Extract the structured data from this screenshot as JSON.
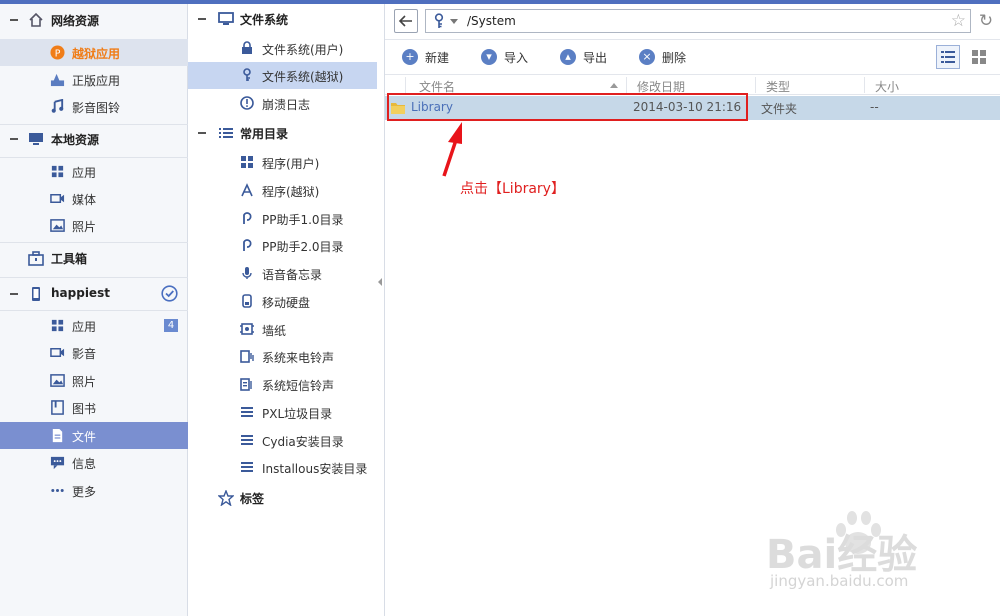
{
  "sidebar": {
    "network": {
      "title": "网络资源",
      "items": [
        {
          "label": "越狱应用"
        },
        {
          "label": "正版应用"
        },
        {
          "label": "影音图铃"
        }
      ]
    },
    "local": {
      "title": "本地资源",
      "items": [
        {
          "label": "应用"
        },
        {
          "label": "媒体"
        },
        {
          "label": "照片"
        }
      ]
    },
    "toolbox": {
      "title": "工具箱"
    },
    "device": {
      "title": "happiest",
      "items": [
        {
          "label": "应用",
          "badge": "4"
        },
        {
          "label": "影音"
        },
        {
          "label": "照片"
        },
        {
          "label": "图书"
        },
        {
          "label": "文件"
        },
        {
          "label": "信息"
        },
        {
          "label": "更多"
        }
      ]
    }
  },
  "middle": {
    "filesystem": {
      "title": "文件系统",
      "items": [
        {
          "label": "文件系统(用户)"
        },
        {
          "label": "文件系统(越狱)"
        },
        {
          "label": "崩溃日志"
        }
      ]
    },
    "common": {
      "title": "常用目录",
      "items": [
        {
          "label": "程序(用户)"
        },
        {
          "label": "程序(越狱)"
        },
        {
          "label": "PP助手1.0目录"
        },
        {
          "label": "PP助手2.0目录"
        },
        {
          "label": "语音备忘录"
        },
        {
          "label": "移动硬盘"
        },
        {
          "label": "墙纸"
        },
        {
          "label": "系统来电铃声"
        },
        {
          "label": "系统短信铃声"
        },
        {
          "label": "PXL垃圾目录"
        },
        {
          "label": "Cydia安装目录"
        },
        {
          "label": "Installous安装目录"
        }
      ]
    },
    "tags": {
      "title": "标签"
    }
  },
  "address": {
    "path": "/System"
  },
  "toolbar": {
    "new_label": "新建",
    "import_label": "导入",
    "export_label": "导出",
    "delete_label": "删除"
  },
  "table": {
    "headers": [
      "文件名",
      "修改日期",
      "类型",
      "大小"
    ],
    "rows": [
      {
        "name": "Library",
        "date": "2014-03-10 21:16",
        "type": "文件夹",
        "size": "--"
      }
    ]
  },
  "annotation": {
    "text": "点击【Library】"
  },
  "watermark": {
    "brand": "Bai经验",
    "url": "jingyan.baidu.com"
  },
  "colors": {
    "accent": "#4f6fbf",
    "selected_orange": "#f07d18",
    "highlight_red": "#e01f1f"
  }
}
